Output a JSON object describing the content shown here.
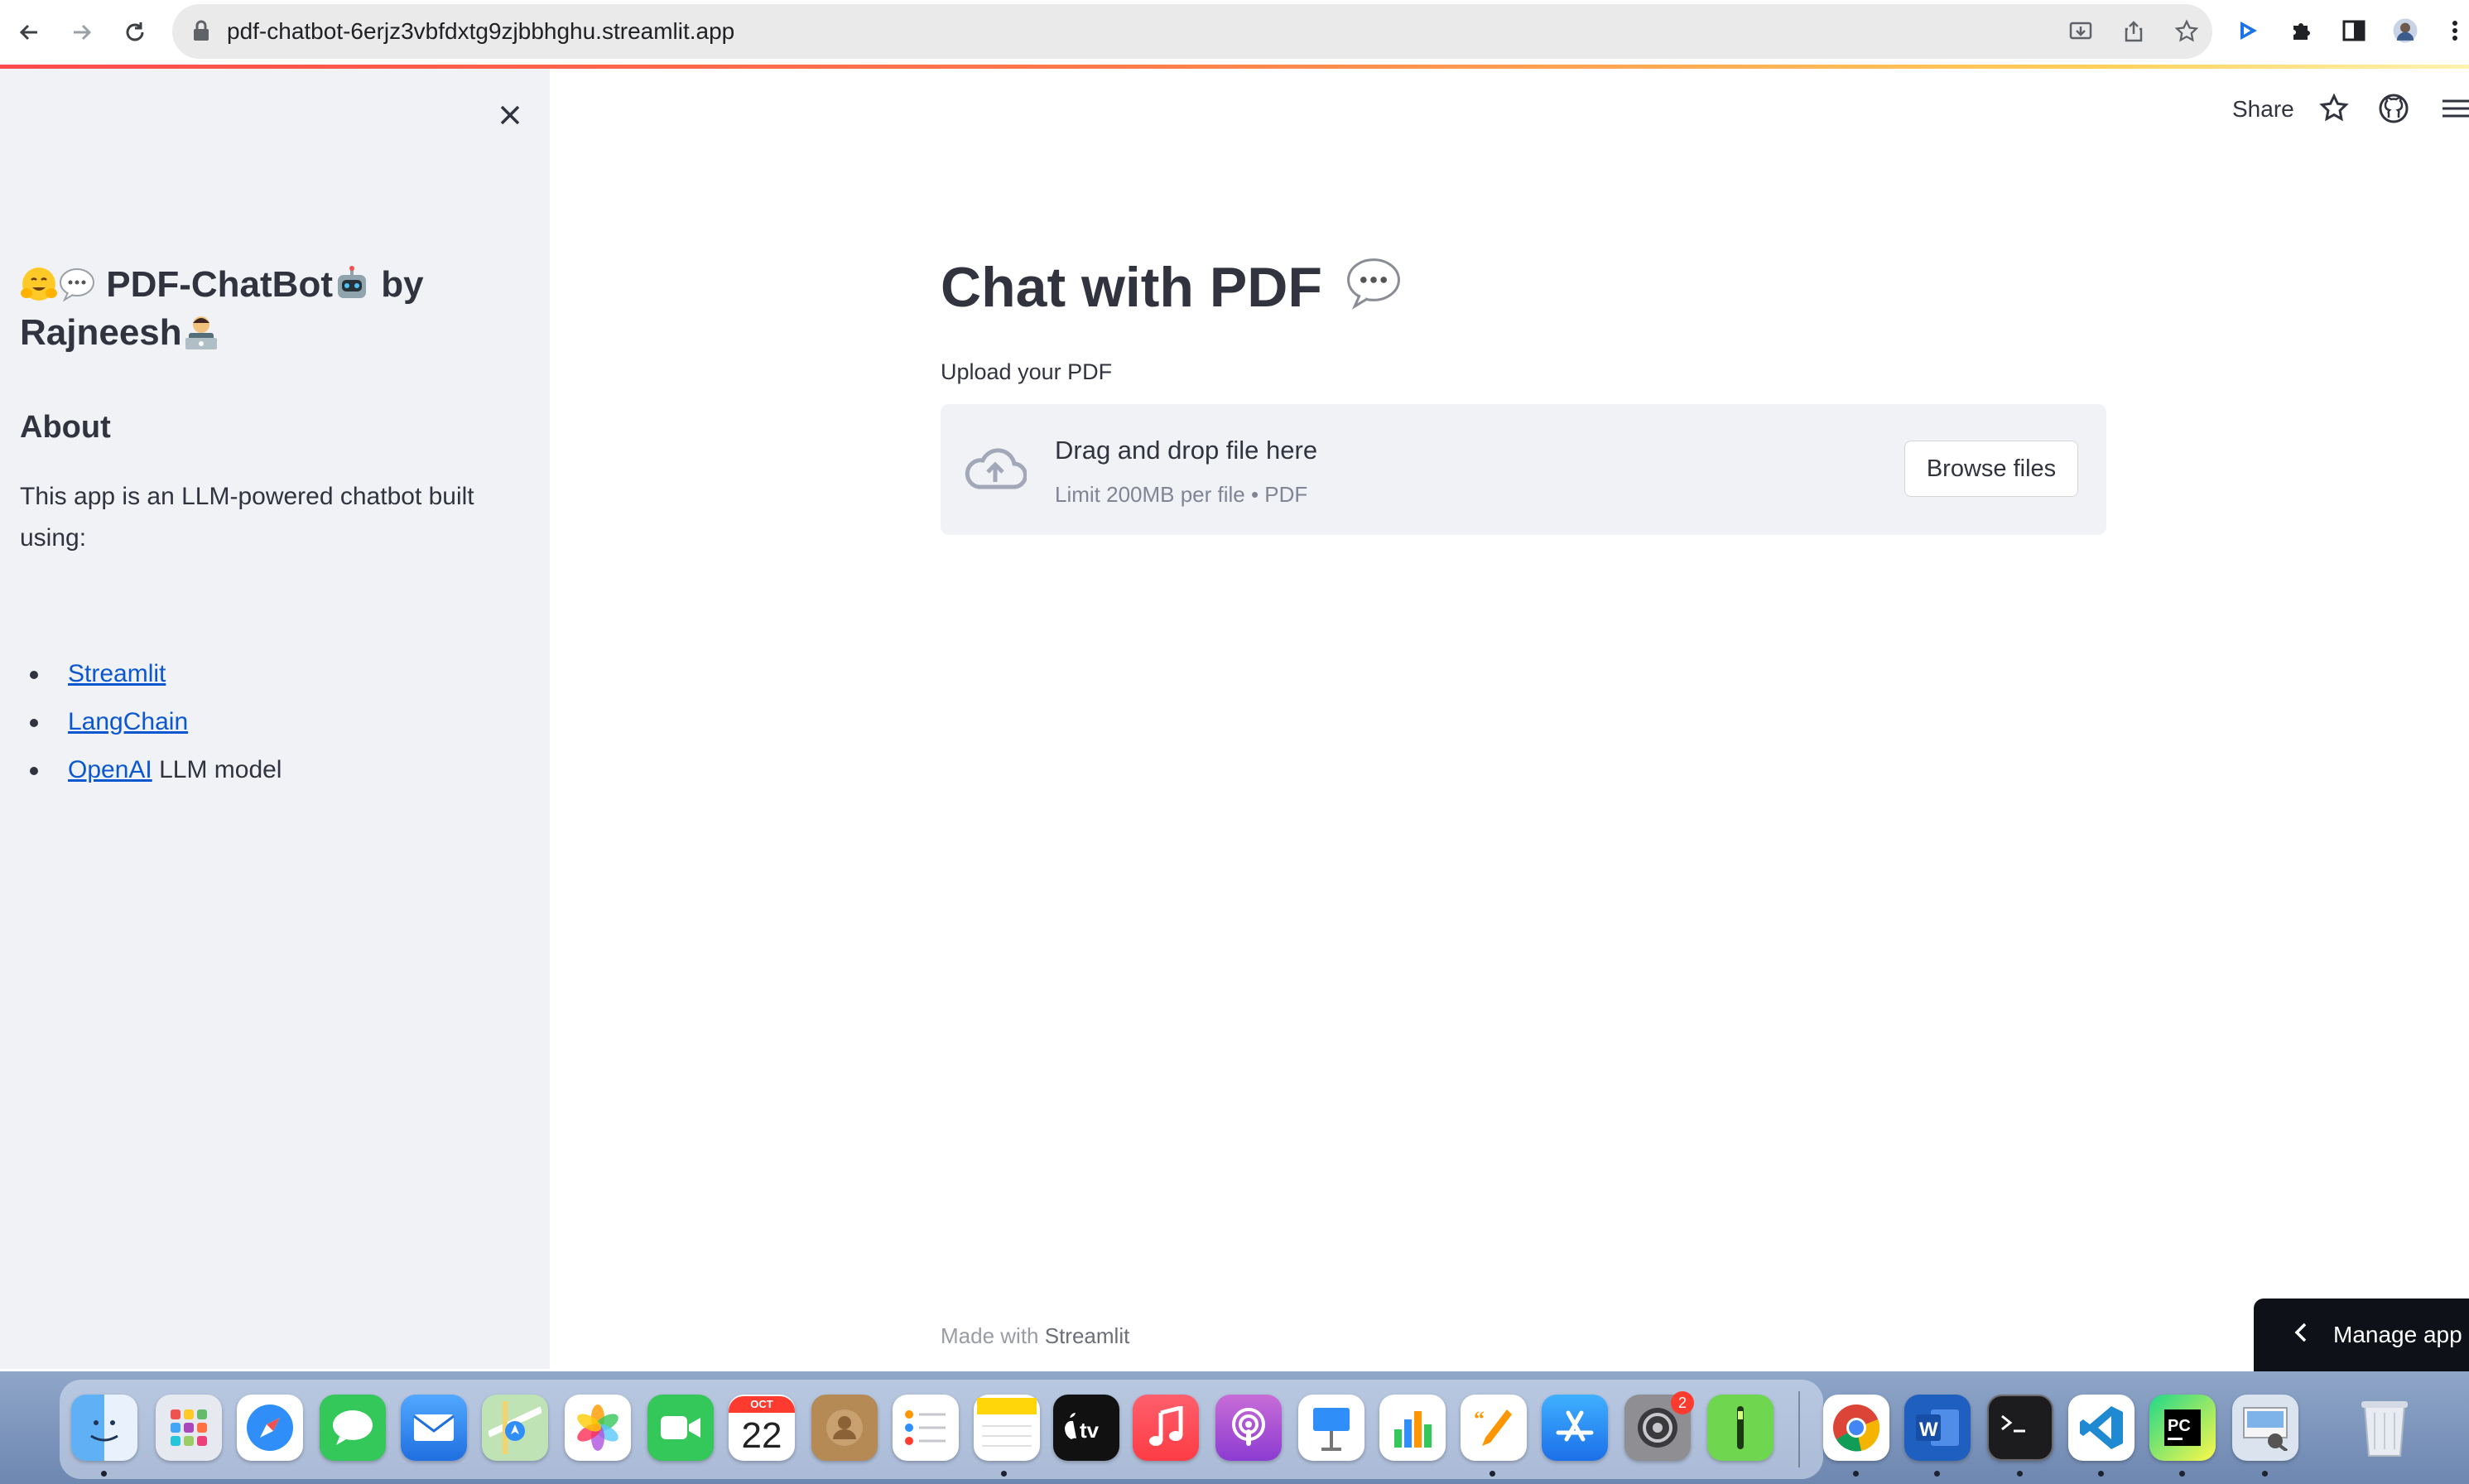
{
  "browser": {
    "url": "pdf-chatbot-6erjz3vbfdxtg9zjbbhghu.streamlit.app"
  },
  "sidebar": {
    "title_part1": "PDF-ChatBot",
    "title_part2": " by",
    "title_part3": "Rajneesh",
    "about_heading": "About",
    "description": "This app is an LLM-powered chatbot built using:",
    "links": [
      {
        "label": "Streamlit",
        "suffix": ""
      },
      {
        "label": "LangChain",
        "suffix": ""
      },
      {
        "label": "OpenAI",
        "suffix": " LLM model"
      }
    ]
  },
  "header": {
    "share_label": "Share"
  },
  "main": {
    "title": "Chat with PDF",
    "upload_label": "Upload your PDF",
    "dropzone_text": "Drag and drop file here",
    "dropzone_limit": "Limit 200MB per file • PDF",
    "browse_button": "Browse files",
    "footer_prefix": "Made with ",
    "footer_brand": "Streamlit",
    "manage_app": "Manage app"
  },
  "dock": {
    "calendar_month": "OCT",
    "calendar_day": "22",
    "settings_badge": "2",
    "apps": [
      "finder-icon",
      "launchpad-icon",
      "safari-icon",
      "messages-icon",
      "mail-icon",
      "maps-icon",
      "photos-icon",
      "facetime-icon",
      "calendar-icon",
      "contacts-icon",
      "reminders-icon",
      "notes-icon",
      "tv-icon",
      "music-icon",
      "podcasts-icon",
      "keynote-icon",
      "numbers-icon",
      "pages-icon",
      "app-store-icon",
      "system-settings-icon",
      "gauge-app-icon",
      "chrome-icon",
      "word-icon",
      "terminal-icon",
      "vscode-icon",
      "pycharm-icon",
      "preview-icon",
      "trash-icon"
    ]
  },
  "colors": {
    "accent": "#ff4b4b",
    "link": "#0b57d0",
    "sidebar_bg": "#f0f2f6",
    "text": "#31333f"
  }
}
